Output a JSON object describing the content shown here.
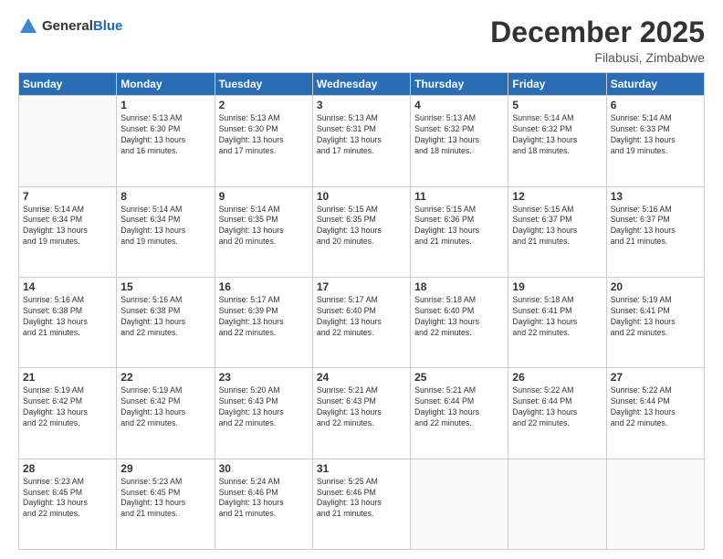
{
  "header": {
    "logo_general": "General",
    "logo_blue": "Blue",
    "month": "December 2025",
    "location": "Filabusi, Zimbabwe"
  },
  "weekdays": [
    "Sunday",
    "Monday",
    "Tuesday",
    "Wednesday",
    "Thursday",
    "Friday",
    "Saturday"
  ],
  "weeks": [
    [
      {
        "day": "",
        "info": ""
      },
      {
        "day": "1",
        "info": "Sunrise: 5:13 AM\nSunset: 6:30 PM\nDaylight: 13 hours\nand 16 minutes."
      },
      {
        "day": "2",
        "info": "Sunrise: 5:13 AM\nSunset: 6:30 PM\nDaylight: 13 hours\nand 17 minutes."
      },
      {
        "day": "3",
        "info": "Sunrise: 5:13 AM\nSunset: 6:31 PM\nDaylight: 13 hours\nand 17 minutes."
      },
      {
        "day": "4",
        "info": "Sunrise: 5:13 AM\nSunset: 6:32 PM\nDaylight: 13 hours\nand 18 minutes."
      },
      {
        "day": "5",
        "info": "Sunrise: 5:14 AM\nSunset: 6:32 PM\nDaylight: 13 hours\nand 18 minutes."
      },
      {
        "day": "6",
        "info": "Sunrise: 5:14 AM\nSunset: 6:33 PM\nDaylight: 13 hours\nand 19 minutes."
      }
    ],
    [
      {
        "day": "7",
        "info": "Sunrise: 5:14 AM\nSunset: 6:34 PM\nDaylight: 13 hours\nand 19 minutes."
      },
      {
        "day": "8",
        "info": "Sunrise: 5:14 AM\nSunset: 6:34 PM\nDaylight: 13 hours\nand 19 minutes."
      },
      {
        "day": "9",
        "info": "Sunrise: 5:14 AM\nSunset: 6:35 PM\nDaylight: 13 hours\nand 20 minutes."
      },
      {
        "day": "10",
        "info": "Sunrise: 5:15 AM\nSunset: 6:35 PM\nDaylight: 13 hours\nand 20 minutes."
      },
      {
        "day": "11",
        "info": "Sunrise: 5:15 AM\nSunset: 6:36 PM\nDaylight: 13 hours\nand 21 minutes."
      },
      {
        "day": "12",
        "info": "Sunrise: 5:15 AM\nSunset: 6:37 PM\nDaylight: 13 hours\nand 21 minutes."
      },
      {
        "day": "13",
        "info": "Sunrise: 5:16 AM\nSunset: 6:37 PM\nDaylight: 13 hours\nand 21 minutes."
      }
    ],
    [
      {
        "day": "14",
        "info": "Sunrise: 5:16 AM\nSunset: 6:38 PM\nDaylight: 13 hours\nand 21 minutes."
      },
      {
        "day": "15",
        "info": "Sunrise: 5:16 AM\nSunset: 6:38 PM\nDaylight: 13 hours\nand 22 minutes."
      },
      {
        "day": "16",
        "info": "Sunrise: 5:17 AM\nSunset: 6:39 PM\nDaylight: 13 hours\nand 22 minutes."
      },
      {
        "day": "17",
        "info": "Sunrise: 5:17 AM\nSunset: 6:40 PM\nDaylight: 13 hours\nand 22 minutes."
      },
      {
        "day": "18",
        "info": "Sunrise: 5:18 AM\nSunset: 6:40 PM\nDaylight: 13 hours\nand 22 minutes."
      },
      {
        "day": "19",
        "info": "Sunrise: 5:18 AM\nSunset: 6:41 PM\nDaylight: 13 hours\nand 22 minutes."
      },
      {
        "day": "20",
        "info": "Sunrise: 5:19 AM\nSunset: 6:41 PM\nDaylight: 13 hours\nand 22 minutes."
      }
    ],
    [
      {
        "day": "21",
        "info": "Sunrise: 5:19 AM\nSunset: 6:42 PM\nDaylight: 13 hours\nand 22 minutes."
      },
      {
        "day": "22",
        "info": "Sunrise: 5:19 AM\nSunset: 6:42 PM\nDaylight: 13 hours\nand 22 minutes."
      },
      {
        "day": "23",
        "info": "Sunrise: 5:20 AM\nSunset: 6:43 PM\nDaylight: 13 hours\nand 22 minutes."
      },
      {
        "day": "24",
        "info": "Sunrise: 5:21 AM\nSunset: 6:43 PM\nDaylight: 13 hours\nand 22 minutes."
      },
      {
        "day": "25",
        "info": "Sunrise: 5:21 AM\nSunset: 6:44 PM\nDaylight: 13 hours\nand 22 minutes."
      },
      {
        "day": "26",
        "info": "Sunrise: 5:22 AM\nSunset: 6:44 PM\nDaylight: 13 hours\nand 22 minutes."
      },
      {
        "day": "27",
        "info": "Sunrise: 5:22 AM\nSunset: 6:44 PM\nDaylight: 13 hours\nand 22 minutes."
      }
    ],
    [
      {
        "day": "28",
        "info": "Sunrise: 5:23 AM\nSunset: 6:45 PM\nDaylight: 13 hours\nand 22 minutes."
      },
      {
        "day": "29",
        "info": "Sunrise: 5:23 AM\nSunset: 6:45 PM\nDaylight: 13 hours\nand 21 minutes."
      },
      {
        "day": "30",
        "info": "Sunrise: 5:24 AM\nSunset: 6:46 PM\nDaylight: 13 hours\nand 21 minutes."
      },
      {
        "day": "31",
        "info": "Sunrise: 5:25 AM\nSunset: 6:46 PM\nDaylight: 13 hours\nand 21 minutes."
      },
      {
        "day": "",
        "info": ""
      },
      {
        "day": "",
        "info": ""
      },
      {
        "day": "",
        "info": ""
      }
    ]
  ]
}
